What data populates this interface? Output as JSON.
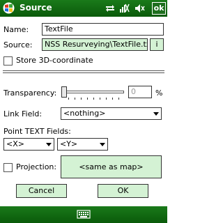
{
  "titlebar": {
    "title": "Source",
    "ok_label": "ok"
  },
  "form": {
    "name_label": "Name:",
    "name_value": "TextFile",
    "source_label": "Source:",
    "source_value": "NSS Resurveying\\TextFile.txt",
    "info_label": "i",
    "store3d_label": "Store 3D-coordinate",
    "store3d_checked": false,
    "transparency_label": "Transparency:",
    "transparency_value": "0",
    "transparency_unit": "%",
    "linkfield_label": "Link Field:",
    "linkfield_value": "<nothing>",
    "point_text_label": "Point TEXT Fields:",
    "x_field_value": "<X>",
    "y_field_value": "<Y>",
    "projection_label": "Projection:",
    "projection_checked": false,
    "projection_value": "<same as map>"
  },
  "buttons": {
    "cancel_label": "Cancel",
    "ok_label": "OK"
  },
  "icons": {
    "start": "windows-start-icon",
    "sync": "sync-icon",
    "signal": "no-signal-icon",
    "volume": "volume-icon",
    "keyboard": "keyboard-icon"
  }
}
